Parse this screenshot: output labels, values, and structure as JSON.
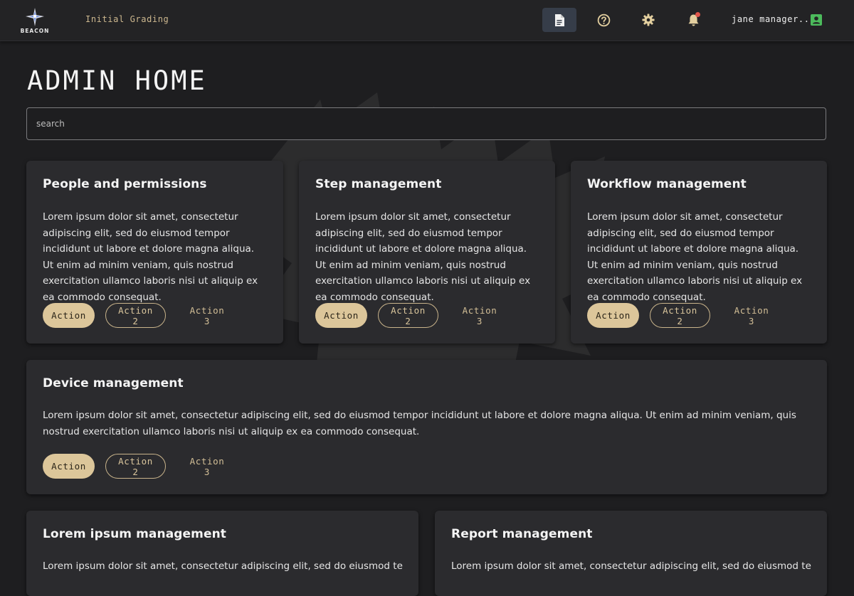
{
  "header": {
    "brand": "BEACON",
    "subtitle": "Initial Grading",
    "icons": [
      "document-icon",
      "help-icon",
      "settings-icon",
      "bell-icon"
    ],
    "user_name": "jane manager...",
    "accent": "#dcc69a",
    "notification_dot": "#e0564b",
    "user_icon_color": "#4cbb5c"
  },
  "page": {
    "title": "ADMIN HOME",
    "search_placeholder": "search"
  },
  "cards": [
    {
      "title": "People and permissions",
      "body": "Lorem ipsum dolor sit amet, consectetur adipiscing elit, sed do eiusmod tempor incididunt ut labore et dolore magna aliqua. Ut enim ad minim veniam, quis nostrud exercitation ullamco laboris nisi ut aliquip ex ea commodo consequat.",
      "actions": [
        "Action",
        "Action 2",
        "Action 3"
      ]
    },
    {
      "title": "Step management",
      "body": "Lorem ipsum dolor sit amet, consectetur adipiscing elit, sed do eiusmod tempor incididunt ut labore et dolore magna aliqua. Ut enim ad minim veniam, quis nostrud exercitation ullamco laboris nisi ut aliquip ex ea commodo consequat.",
      "actions": [
        "Action",
        "Action 2",
        "Action 3"
      ]
    },
    {
      "title": "Workflow management",
      "body": "Lorem ipsum dolor sit amet, consectetur adipiscing elit, sed do eiusmod tempor incididunt ut labore et dolore magna aliqua. Ut enim ad minim veniam, quis nostrud exercitation ullamco laboris nisi ut aliquip ex ea commodo consequat.",
      "actions": [
        "Action",
        "Action 2",
        "Action 3"
      ]
    },
    {
      "title": "Device management",
      "body": "Lorem ipsum dolor sit amet, consectetur adipiscing elit, sed do eiusmod tempor incididunt ut labore et dolore magna aliqua. Ut enim ad minim veniam, quis nostrud exercitation ullamco laboris nisi ut aliquip ex ea commodo consequat.",
      "actions": [
        "Action",
        "Action 2",
        "Action 3"
      ]
    },
    {
      "title": "Lorem ipsum management",
      "body": "Lorem ipsum dolor sit amet, consectetur adipiscing elit, sed do eiusmod tempor",
      "actions": []
    },
    {
      "title": "Report management",
      "body": "Lorem ipsum dolor sit amet, consectetur adipiscing elit, sed do eiusmod tempor",
      "actions": []
    }
  ]
}
